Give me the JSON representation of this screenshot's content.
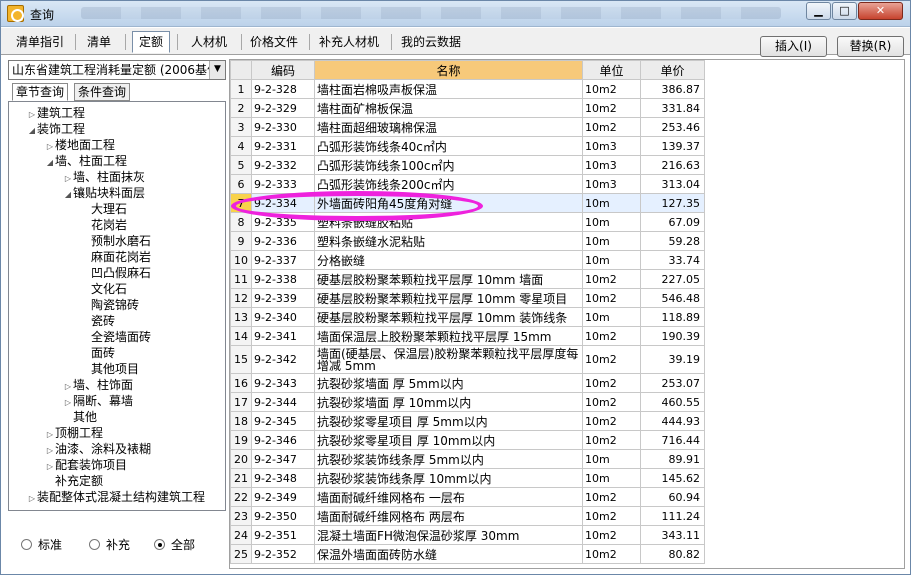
{
  "window": {
    "title": "查询"
  },
  "tabs": [
    {
      "label": "清单指引",
      "active": false
    },
    {
      "label": "清单",
      "active": false
    },
    {
      "label": "定额",
      "active": true
    },
    {
      "label": "人材机",
      "active": false
    },
    {
      "label": "价格文件",
      "active": false
    },
    {
      "label": "补充人材机",
      "active": false
    },
    {
      "label": "我的云数据",
      "active": false
    }
  ],
  "actions": {
    "insert": "插入(I)",
    "replace": "替换(R)"
  },
  "left": {
    "quota_library": "山东省建筑工程消耗量定额 (2006基价",
    "subtabs": [
      "章节查询",
      "条件查询"
    ],
    "tree": [
      {
        "label": "建筑工程",
        "level": 0,
        "state": "collapsed"
      },
      {
        "label": "装饰工程",
        "level": 0,
        "state": "expanded"
      },
      {
        "label": "楼地面工程",
        "level": 1,
        "state": "collapsed"
      },
      {
        "label": "墙、柱面工程",
        "level": 1,
        "state": "expanded"
      },
      {
        "label": "墙、柱面抹灰",
        "level": 2,
        "state": "collapsed"
      },
      {
        "label": "镶贴块料面层",
        "level": 2,
        "state": "expanded"
      },
      {
        "label": "大理石",
        "level": 3,
        "state": "leaf"
      },
      {
        "label": "花岗岩",
        "level": 3,
        "state": "leaf"
      },
      {
        "label": "预制水磨石",
        "level": 3,
        "state": "leaf"
      },
      {
        "label": "麻面花岗岩",
        "level": 3,
        "state": "leaf"
      },
      {
        "label": "凹凸假麻石",
        "level": 3,
        "state": "leaf"
      },
      {
        "label": "文化石",
        "level": 3,
        "state": "leaf"
      },
      {
        "label": "陶瓷锦砖",
        "level": 3,
        "state": "leaf"
      },
      {
        "label": "瓷砖",
        "level": 3,
        "state": "leaf"
      },
      {
        "label": "全瓷墙面砖",
        "level": 3,
        "state": "leaf"
      },
      {
        "label": "面砖",
        "level": 3,
        "state": "leaf"
      },
      {
        "label": "其他项目",
        "level": 3,
        "state": "leaf"
      },
      {
        "label": "墙、柱饰面",
        "level": 2,
        "state": "collapsed"
      },
      {
        "label": "隔断、幕墙",
        "level": 2,
        "state": "collapsed"
      },
      {
        "label": "其他",
        "level": 2,
        "state": "leaf"
      },
      {
        "label": "顶棚工程",
        "level": 1,
        "state": "collapsed"
      },
      {
        "label": "油漆、涂料及裱糊",
        "level": 1,
        "state": "collapsed"
      },
      {
        "label": "配套装饰项目",
        "level": 1,
        "state": "collapsed"
      },
      {
        "label": "补充定额",
        "level": 1,
        "state": "leaf"
      },
      {
        "label": "装配整体式混凝土结构建筑工程",
        "level": 0,
        "state": "collapsed"
      }
    ],
    "filter": {
      "options": [
        "标准",
        "补充",
        "全部"
      ],
      "selected": "全部"
    }
  },
  "grid": {
    "columns": [
      "",
      "编码",
      "名称",
      "单位",
      "单价"
    ],
    "selected_row": 7,
    "rows": [
      [
        "1",
        "9-2-328",
        "墙柱面岩棉吸声板保温",
        "10m2",
        "386.87"
      ],
      [
        "2",
        "9-2-329",
        "墙柱面矿棉板保温",
        "10m2",
        "331.84"
      ],
      [
        "3",
        "9-2-330",
        "墙柱面超细玻璃棉保温",
        "10m2",
        "253.46"
      ],
      [
        "4",
        "9-2-331",
        "凸弧形装饰线条40c㎡内",
        "10m3",
        "139.37"
      ],
      [
        "5",
        "9-2-332",
        "凸弧形装饰线条100c㎡内",
        "10m3",
        "216.63"
      ],
      [
        "6",
        "9-2-333",
        "凸弧形装饰线条200c㎡内",
        "10m3",
        "313.04"
      ],
      [
        "7",
        "9-2-334",
        "外墙面砖阳角45度角对缝",
        "10m",
        "127.35"
      ],
      [
        "8",
        "9-2-335",
        "塑料条嵌缝胶粘贴",
        "10m",
        "67.09"
      ],
      [
        "9",
        "9-2-336",
        "塑料条嵌缝水泥粘贴",
        "10m",
        "59.28"
      ],
      [
        "10",
        "9-2-337",
        "分格嵌缝",
        "10m",
        "33.74"
      ],
      [
        "11",
        "9-2-338",
        "硬基层胶粉聚苯颗粒找平层厚 10mm 墙面",
        "10m2",
        "227.05"
      ],
      [
        "12",
        "9-2-339",
        "硬基层胶粉聚苯颗粒找平层厚 10mm 零星项目",
        "10m2",
        "546.48"
      ],
      [
        "13",
        "9-2-340",
        "硬基层胶粉聚苯颗粒找平层厚 10mm 装饰线条",
        "10m",
        "118.89"
      ],
      [
        "14",
        "9-2-341",
        "墙面保温层上胶粉聚苯颗粒找平层厚 15mm",
        "10m2",
        "190.39"
      ],
      [
        "15",
        "9-2-342",
        "墙面(硬基层、保温层)胶粉聚苯颗粒找平层厚度每增减 5mm",
        "10m2",
        "39.19"
      ],
      [
        "16",
        "9-2-343",
        "抗裂砂浆墙面 厚 5mm以内",
        "10m2",
        "253.07"
      ],
      [
        "17",
        "9-2-344",
        "抗裂砂浆墙面 厚 10mm以内",
        "10m2",
        "460.55"
      ],
      [
        "18",
        "9-2-345",
        "抗裂砂浆零星项目 厚 5mm以内",
        "10m2",
        "444.93"
      ],
      [
        "19",
        "9-2-346",
        "抗裂砂浆零星项目 厚 10mm以内",
        "10m2",
        "716.44"
      ],
      [
        "20",
        "9-2-347",
        "抗裂砂浆装饰线条厚 5mm以内",
        "10m",
        "89.91"
      ],
      [
        "21",
        "9-2-348",
        "抗裂砂浆装饰线条厚 10mm以内",
        "10m",
        "145.62"
      ],
      [
        "22",
        "9-2-349",
        "墙面耐碱纤维网格布 一层布",
        "10m2",
        "60.94"
      ],
      [
        "23",
        "9-2-350",
        "墙面耐碱纤维网格布 两层布",
        "10m2",
        "111.24"
      ],
      [
        "24",
        "9-2-351",
        "混凝土墙面FH微泡保温砂浆厚 30mm",
        "10m2",
        "343.11"
      ],
      [
        "25",
        "9-2-352",
        "保温外墙面面砖防水缝",
        "10m2",
        "80.82"
      ]
    ]
  }
}
